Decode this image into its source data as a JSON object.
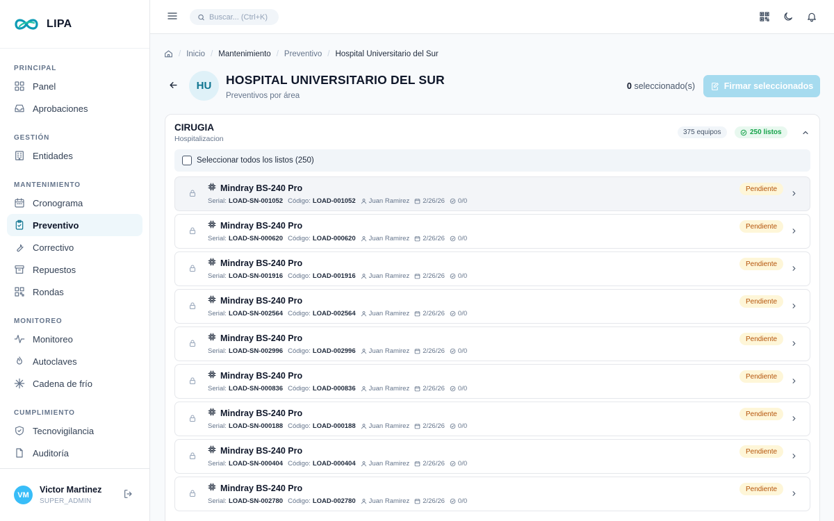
{
  "app": {
    "name": "LIPA",
    "logo": "lipa-infinity-logo"
  },
  "sidebar": {
    "sections": [
      {
        "title": "PRINCIPAL",
        "items": [
          {
            "label": "Panel",
            "icon": "layout-grid-icon"
          },
          {
            "label": "Aprobaciones",
            "icon": "inbox-icon"
          }
        ]
      },
      {
        "title": "GESTIÓN",
        "items": [
          {
            "label": "Entidades",
            "icon": "building-icon"
          }
        ]
      },
      {
        "title": "MANTENIMIENTO",
        "items": [
          {
            "label": "Cronograma",
            "icon": "calendar-icon"
          },
          {
            "label": "Preventivo",
            "icon": "clipboard-check-icon",
            "active": true
          },
          {
            "label": "Correctivo",
            "icon": "wrench-icon"
          },
          {
            "label": "Repuestos",
            "icon": "archive-icon"
          },
          {
            "label": "Rondas",
            "icon": "qr-code-icon"
          }
        ]
      },
      {
        "title": "MONITOREO",
        "items": [
          {
            "label": "Monitoreo",
            "icon": "activity-icon"
          },
          {
            "label": "Autoclaves",
            "icon": "flame-icon"
          },
          {
            "label": "Cadena de frío",
            "icon": "snowflake-icon"
          }
        ]
      },
      {
        "title": "CUMPLIMIENTO",
        "items": [
          {
            "label": "Tecnovigilancia",
            "icon": "shield-icon"
          },
          {
            "label": "Auditoría",
            "icon": "file-icon"
          }
        ]
      }
    ],
    "user": {
      "initials": "VM",
      "name": "Victor Martinez",
      "role": "SUPER_ADMIN"
    }
  },
  "topbar": {
    "search_placeholder": "Buscar... (Ctrl+K)"
  },
  "breadcrumb": [
    "Inicio",
    "Mantenimiento",
    "Preventivo",
    "Hospital Universitario del Sur"
  ],
  "header": {
    "initials": "HU",
    "title": "HOSPITAL UNIVERSITARIO DEL SUR",
    "subtitle": "Preventivos por área",
    "selected_count": "0",
    "selected_label": "seleccionado(s)",
    "sign_button": "Firmar seleccionados"
  },
  "area": {
    "title": "CIRUGIA",
    "subtitle": "Hospitalizacion",
    "equipment_count": "375 equipos",
    "ready_count": "250 listos",
    "select_all_label": "Seleccionar todos los listos (250)"
  },
  "labels": {
    "serial": "Serial:",
    "code": "Código:"
  },
  "rows": [
    {
      "name": "Mindray BS-240 Pro",
      "serial": "LOAD-SN-001052",
      "code": "LOAD-001052",
      "tech": "Juan Ramirez",
      "date": "2/26/26",
      "progress": "0/0",
      "status": "Pendiente"
    },
    {
      "name": "Mindray BS-240 Pro",
      "serial": "LOAD-SN-000620",
      "code": "LOAD-000620",
      "tech": "Juan Ramirez",
      "date": "2/26/26",
      "progress": "0/0",
      "status": "Pendiente"
    },
    {
      "name": "Mindray BS-240 Pro",
      "serial": "LOAD-SN-001916",
      "code": "LOAD-001916",
      "tech": "Juan Ramirez",
      "date": "2/26/26",
      "progress": "0/0",
      "status": "Pendiente"
    },
    {
      "name": "Mindray BS-240 Pro",
      "serial": "LOAD-SN-002564",
      "code": "LOAD-002564",
      "tech": "Juan Ramirez",
      "date": "2/26/26",
      "progress": "0/0",
      "status": "Pendiente"
    },
    {
      "name": "Mindray BS-240 Pro",
      "serial": "LOAD-SN-002996",
      "code": "LOAD-002996",
      "tech": "Juan Ramirez",
      "date": "2/26/26",
      "progress": "0/0",
      "status": "Pendiente"
    },
    {
      "name": "Mindray BS-240 Pro",
      "serial": "LOAD-SN-000836",
      "code": "LOAD-000836",
      "tech": "Juan Ramirez",
      "date": "2/26/26",
      "progress": "0/0",
      "status": "Pendiente"
    },
    {
      "name": "Mindray BS-240 Pro",
      "serial": "LOAD-SN-000188",
      "code": "LOAD-000188",
      "tech": "Juan Ramirez",
      "date": "2/26/26",
      "progress": "0/0",
      "status": "Pendiente"
    },
    {
      "name": "Mindray BS-240 Pro",
      "serial": "LOAD-SN-000404",
      "code": "LOAD-000404",
      "tech": "Juan Ramirez",
      "date": "2/26/26",
      "progress": "0/0",
      "status": "Pendiente"
    },
    {
      "name": "Mindray BS-240 Pro",
      "serial": "LOAD-SN-002780",
      "code": "LOAD-002780",
      "tech": "Juan Ramirez",
      "date": "2/26/26",
      "progress": "0/0",
      "status": "Pendiente"
    }
  ],
  "colors": {
    "accent": "#0e7490",
    "button_disabled": "#a6dbef",
    "pending_bg": "#fef6d8",
    "pending_text": "#b45309",
    "ready": "#16a34a"
  }
}
